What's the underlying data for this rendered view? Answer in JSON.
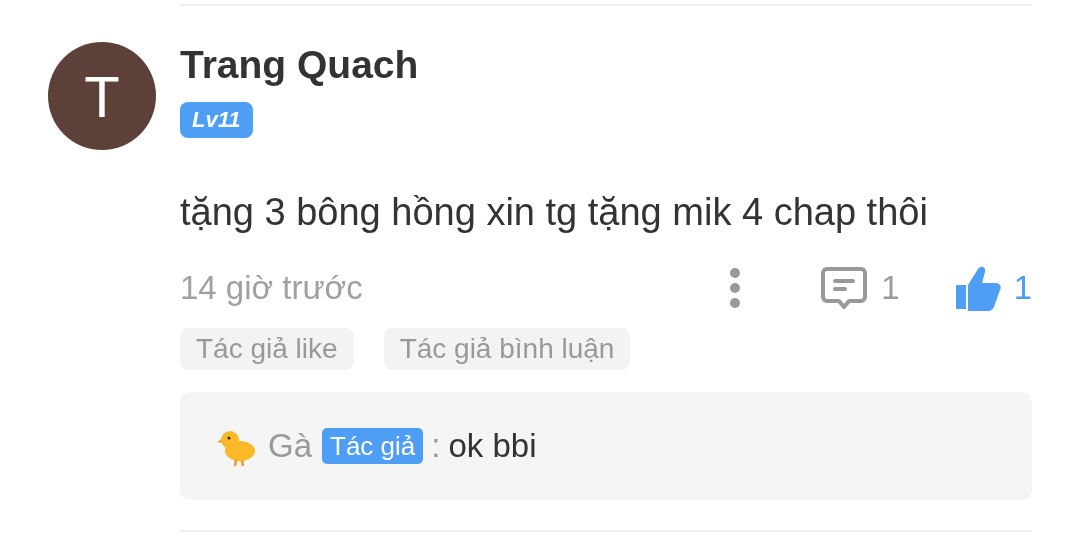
{
  "comment": {
    "author": {
      "initial": "T",
      "name": "Trang Quach",
      "level_badge": "Lv11"
    },
    "text": "tặng 3 bông hồng xin tg tặng mik 4 chap thôi",
    "time": "14 giờ trước",
    "reply_count": "1",
    "like_count": "1",
    "liked": true,
    "tags": [
      "Tác giả like",
      "Tác giả bình luận"
    ],
    "replies": [
      {
        "name": "Gà",
        "badge": "Tác giả",
        "separator": ":",
        "text": "ok bbi"
      }
    ]
  }
}
